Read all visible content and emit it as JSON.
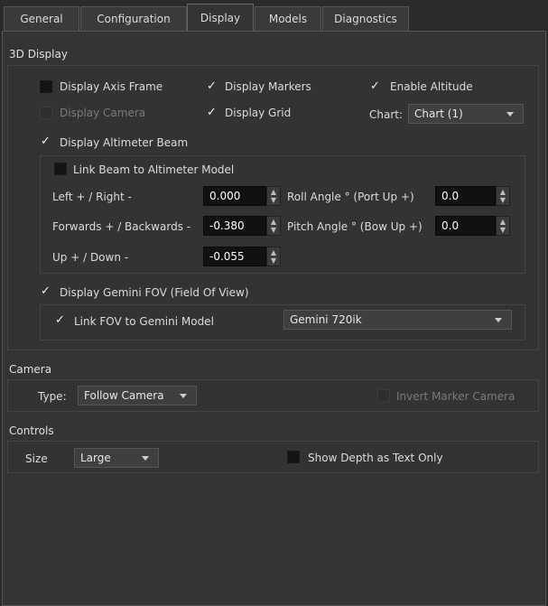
{
  "tabs": [
    {
      "label": "General"
    },
    {
      "label": "Configuration"
    },
    {
      "label": "Display",
      "active": true
    },
    {
      "label": "Models"
    },
    {
      "label": "Diagnostics"
    }
  ],
  "display3d": {
    "title": "3D Display",
    "axis_frame": {
      "label": "Display Axis Frame",
      "checked": false
    },
    "markers": {
      "label": "Display Markers",
      "checked": true
    },
    "altitude": {
      "label": "Enable Altitude",
      "checked": true
    },
    "camera": {
      "label": "Display Camera",
      "checked": false,
      "disabled": true
    },
    "grid": {
      "label": "Display Grid",
      "checked": true
    },
    "chart_label": "Chart:",
    "chart_value": "Chart (1)",
    "altimeter_beam": {
      "label": "Display Altimeter Beam",
      "checked": true
    },
    "link_beam": {
      "label": "Link Beam to Altimeter Model",
      "checked": false
    },
    "left_right": {
      "label": "Left + / Right -",
      "value": "0.000"
    },
    "fwd_back": {
      "label": "Forwards + / Backwards -",
      "value": "-0.380"
    },
    "up_down": {
      "label": "Up + / Down -",
      "value": "-0.055"
    },
    "roll": {
      "label": "Roll Angle ° (Port Up +)",
      "value": "0.0"
    },
    "pitch": {
      "label": "Pitch Angle ° (Bow Up +)",
      "value": "0.0"
    },
    "gemini_fov": {
      "label": "Display Gemini FOV (Field Of View)",
      "checked": true
    },
    "link_fov": {
      "label": "Link FOV to Gemini Model",
      "checked": true
    },
    "gemini_model": "Gemini 720ik"
  },
  "camera": {
    "title": "Camera",
    "type_label": "Type:",
    "type_value": "Follow Camera",
    "invert": {
      "label": "Invert Marker Camera",
      "checked": false,
      "disabled": true
    }
  },
  "controls": {
    "title": "Controls",
    "size_label": "Size",
    "size_value": "Large",
    "depth_text": {
      "label": "Show Depth as Text Only",
      "checked": false
    }
  },
  "glyphs": {
    "check": "✓",
    "spin_up": "▲",
    "spin_down": "▼"
  }
}
